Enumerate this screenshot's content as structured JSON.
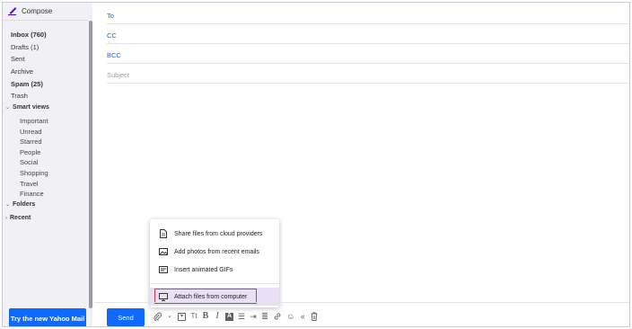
{
  "sidebar": {
    "compose_label": "Compose",
    "folders": [
      {
        "label": "Inbox (760)",
        "bold": true
      },
      {
        "label": "Drafts (1)",
        "bold": false
      },
      {
        "label": "Sent",
        "bold": false
      },
      {
        "label": "Archive",
        "bold": false
      },
      {
        "label": "Spam (25)",
        "bold": true
      },
      {
        "label": "Trash",
        "bold": false
      }
    ],
    "smart_views_label": "Smart views",
    "smart_views": [
      "Important",
      "Unread",
      "Starred",
      "People",
      "Social",
      "Shopping",
      "Travel",
      "Finance"
    ],
    "folders_label": "Folders",
    "recent_label": "Recent",
    "try_button": "Try the new Yahoo Mail"
  },
  "compose": {
    "to_label": "To",
    "cc_label": "CC",
    "bcc_label": "BCC",
    "subject_label": "Subject"
  },
  "toolbar": {
    "send_label": "Send",
    "tools": [
      {
        "name": "attach-icon",
        "glyph": "⌀"
      },
      {
        "name": "attach-dropdown-icon",
        "glyph": "⌄"
      },
      {
        "name": "insert-image-icon",
        "glyph": "▣"
      },
      {
        "name": "font-size-icon",
        "glyph": "Tt"
      },
      {
        "name": "bold-icon",
        "glyph": "B"
      },
      {
        "name": "italic-icon",
        "glyph": "I"
      },
      {
        "name": "text-color-icon",
        "glyph": "A"
      },
      {
        "name": "bulleted-list-icon",
        "glyph": "☰"
      },
      {
        "name": "indent-icon",
        "glyph": "⇥"
      },
      {
        "name": "align-icon",
        "glyph": "≣"
      },
      {
        "name": "link-icon",
        "glyph": "∞"
      },
      {
        "name": "emoji-icon",
        "glyph": "☺"
      },
      {
        "name": "collapse-icon",
        "glyph": "«"
      },
      {
        "name": "trash-icon",
        "glyph": "🗑"
      }
    ]
  },
  "attach_menu": {
    "items": [
      {
        "label": "Share files from cloud providers",
        "icon": "cloud-file-icon"
      },
      {
        "label": "Add photos from recent emails",
        "icon": "photo-icon"
      },
      {
        "label": "Insert animated GIFs",
        "icon": "gif-icon"
      },
      {
        "label": "Attach files from computer",
        "icon": "computer-icon"
      }
    ]
  },
  "colors": {
    "accent": "#0f69ff",
    "compose_icon": "#6001d2",
    "sidebar_bg": "#f1f1f5",
    "highlight_border": "#e0344a",
    "active_item_bg": "#e9e0f5"
  }
}
